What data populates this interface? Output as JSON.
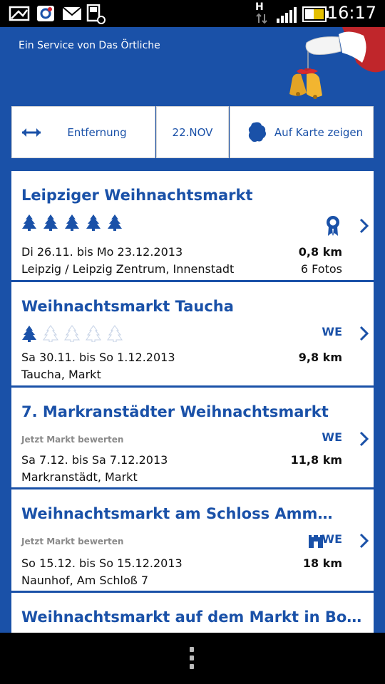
{
  "status_bar": {
    "time": "16:17",
    "network_label": "H"
  },
  "header": {
    "service_text": "Ein Service von Das Örtliche"
  },
  "toolbar": {
    "distance_label": "Entfernung",
    "date_label": "22.NOV",
    "map_label": "Auf Karte zeigen"
  },
  "markets": [
    {
      "title": "Leipziger Weihnachtsmarkt",
      "rating_filled": 5,
      "rating_total": 5,
      "rate_prompt": "",
      "dates": "Di 26.11. bis Mo 23.12.2013",
      "location": "Leipzig / Leipzig Zentrum, Innenstadt",
      "distance": "0,8 km",
      "fotos": "6 Fotos",
      "badge": "award",
      "we": ""
    },
    {
      "title": "Weihnachtsmarkt Taucha",
      "rating_filled": 1,
      "rating_total": 5,
      "rate_prompt": "",
      "dates": "Sa 30.11. bis So 1.12.2013",
      "location": "Taucha, Markt",
      "distance": "9,8 km",
      "fotos": "",
      "badge": "",
      "we": "WE"
    },
    {
      "title": "7. Markranstädter Weihnachtsmarkt",
      "rating_filled": 0,
      "rating_total": 0,
      "rate_prompt": "Jetzt Markt bewerten",
      "dates": "Sa 7.12. bis Sa 7.12.2013",
      "location": "Markranstädt, Markt",
      "distance": "11,8 km",
      "fotos": "",
      "badge": "",
      "we": "WE"
    },
    {
      "title": "Weihnachtsmarkt am Schloss Ammelsh…",
      "rating_filled": 0,
      "rating_total": 0,
      "rate_prompt": "Jetzt Markt bewerten",
      "dates": "So 15.12. bis So 15.12.2013",
      "location": "Naunhof, Am Schloß 7",
      "distance": "18 km",
      "fotos": "",
      "badge": "castle",
      "we": "WE"
    },
    {
      "title": "Weihnachtsmarkt auf dem Markt in Borna",
      "rating_filled": 0,
      "rating_total": 0,
      "rate_prompt": "",
      "dates": "",
      "location": "",
      "distance": "",
      "fotos": "",
      "badge": "",
      "we": ""
    }
  ],
  "colors": {
    "brand_blue": "#1a51a8",
    "background_black": "#000000"
  },
  "icons": {
    "status": [
      "picture-frame-icon",
      "app-notification-icon",
      "mail-icon",
      "sd-card-settings-icon",
      "signal-icon",
      "battery-icon"
    ],
    "toolbar": [
      "double-arrow-icon",
      "map-pin-region-icon"
    ],
    "list": [
      "tree-icon",
      "award-ribbon-icon",
      "castle-icon",
      "chevron-right-icon"
    ],
    "nav": [
      "menu-dots-icon"
    ]
  }
}
